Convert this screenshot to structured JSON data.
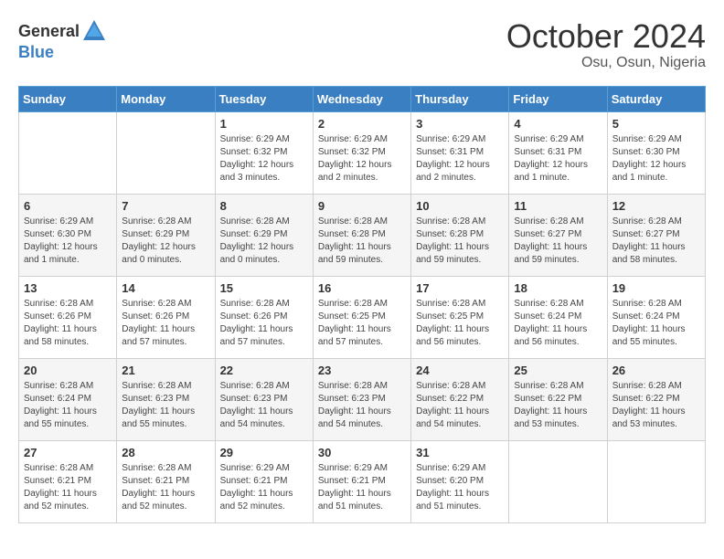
{
  "logo": {
    "general": "General",
    "blue": "Blue"
  },
  "title": "October 2024",
  "location": "Osu, Osun, Nigeria",
  "headers": [
    "Sunday",
    "Monday",
    "Tuesday",
    "Wednesday",
    "Thursday",
    "Friday",
    "Saturday"
  ],
  "weeks": [
    [
      {
        "day": "",
        "content": ""
      },
      {
        "day": "",
        "content": ""
      },
      {
        "day": "1",
        "content": "Sunrise: 6:29 AM\nSunset: 6:32 PM\nDaylight: 12 hours\nand 3 minutes."
      },
      {
        "day": "2",
        "content": "Sunrise: 6:29 AM\nSunset: 6:32 PM\nDaylight: 12 hours\nand 2 minutes."
      },
      {
        "day": "3",
        "content": "Sunrise: 6:29 AM\nSunset: 6:31 PM\nDaylight: 12 hours\nand 2 minutes."
      },
      {
        "day": "4",
        "content": "Sunrise: 6:29 AM\nSunset: 6:31 PM\nDaylight: 12 hours\nand 1 minute."
      },
      {
        "day": "5",
        "content": "Sunrise: 6:29 AM\nSunset: 6:30 PM\nDaylight: 12 hours\nand 1 minute."
      }
    ],
    [
      {
        "day": "6",
        "content": "Sunrise: 6:29 AM\nSunset: 6:30 PM\nDaylight: 12 hours\nand 1 minute."
      },
      {
        "day": "7",
        "content": "Sunrise: 6:28 AM\nSunset: 6:29 PM\nDaylight: 12 hours\nand 0 minutes."
      },
      {
        "day": "8",
        "content": "Sunrise: 6:28 AM\nSunset: 6:29 PM\nDaylight: 12 hours\nand 0 minutes."
      },
      {
        "day": "9",
        "content": "Sunrise: 6:28 AM\nSunset: 6:28 PM\nDaylight: 11 hours\nand 59 minutes."
      },
      {
        "day": "10",
        "content": "Sunrise: 6:28 AM\nSunset: 6:28 PM\nDaylight: 11 hours\nand 59 minutes."
      },
      {
        "day": "11",
        "content": "Sunrise: 6:28 AM\nSunset: 6:27 PM\nDaylight: 11 hours\nand 59 minutes."
      },
      {
        "day": "12",
        "content": "Sunrise: 6:28 AM\nSunset: 6:27 PM\nDaylight: 11 hours\nand 58 minutes."
      }
    ],
    [
      {
        "day": "13",
        "content": "Sunrise: 6:28 AM\nSunset: 6:26 PM\nDaylight: 11 hours\nand 58 minutes."
      },
      {
        "day": "14",
        "content": "Sunrise: 6:28 AM\nSunset: 6:26 PM\nDaylight: 11 hours\nand 57 minutes."
      },
      {
        "day": "15",
        "content": "Sunrise: 6:28 AM\nSunset: 6:26 PM\nDaylight: 11 hours\nand 57 minutes."
      },
      {
        "day": "16",
        "content": "Sunrise: 6:28 AM\nSunset: 6:25 PM\nDaylight: 11 hours\nand 57 minutes."
      },
      {
        "day": "17",
        "content": "Sunrise: 6:28 AM\nSunset: 6:25 PM\nDaylight: 11 hours\nand 56 minutes."
      },
      {
        "day": "18",
        "content": "Sunrise: 6:28 AM\nSunset: 6:24 PM\nDaylight: 11 hours\nand 56 minutes."
      },
      {
        "day": "19",
        "content": "Sunrise: 6:28 AM\nSunset: 6:24 PM\nDaylight: 11 hours\nand 55 minutes."
      }
    ],
    [
      {
        "day": "20",
        "content": "Sunrise: 6:28 AM\nSunset: 6:24 PM\nDaylight: 11 hours\nand 55 minutes."
      },
      {
        "day": "21",
        "content": "Sunrise: 6:28 AM\nSunset: 6:23 PM\nDaylight: 11 hours\nand 55 minutes."
      },
      {
        "day": "22",
        "content": "Sunrise: 6:28 AM\nSunset: 6:23 PM\nDaylight: 11 hours\nand 54 minutes."
      },
      {
        "day": "23",
        "content": "Sunrise: 6:28 AM\nSunset: 6:23 PM\nDaylight: 11 hours\nand 54 minutes."
      },
      {
        "day": "24",
        "content": "Sunrise: 6:28 AM\nSunset: 6:22 PM\nDaylight: 11 hours\nand 54 minutes."
      },
      {
        "day": "25",
        "content": "Sunrise: 6:28 AM\nSunset: 6:22 PM\nDaylight: 11 hours\nand 53 minutes."
      },
      {
        "day": "26",
        "content": "Sunrise: 6:28 AM\nSunset: 6:22 PM\nDaylight: 11 hours\nand 53 minutes."
      }
    ],
    [
      {
        "day": "27",
        "content": "Sunrise: 6:28 AM\nSunset: 6:21 PM\nDaylight: 11 hours\nand 52 minutes."
      },
      {
        "day": "28",
        "content": "Sunrise: 6:28 AM\nSunset: 6:21 PM\nDaylight: 11 hours\nand 52 minutes."
      },
      {
        "day": "29",
        "content": "Sunrise: 6:29 AM\nSunset: 6:21 PM\nDaylight: 11 hours\nand 52 minutes."
      },
      {
        "day": "30",
        "content": "Sunrise: 6:29 AM\nSunset: 6:21 PM\nDaylight: 11 hours\nand 51 minutes."
      },
      {
        "day": "31",
        "content": "Sunrise: 6:29 AM\nSunset: 6:20 PM\nDaylight: 11 hours\nand 51 minutes."
      },
      {
        "day": "",
        "content": ""
      },
      {
        "day": "",
        "content": ""
      }
    ]
  ]
}
